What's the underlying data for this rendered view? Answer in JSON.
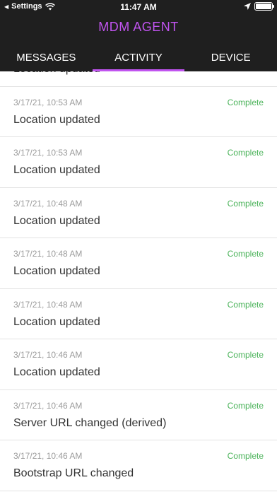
{
  "status_bar": {
    "back_label": "◀",
    "carrier": "Settings",
    "time": "11:47 AM",
    "battery_level": 1.0
  },
  "app": {
    "title": "MDM AGENT"
  },
  "tabs": [
    {
      "label": "MESSAGES",
      "active": false
    },
    {
      "label": "ACTIVITY",
      "active": true
    },
    {
      "label": "DEVICE",
      "active": false
    }
  ],
  "colors": {
    "accent": "#c154f0",
    "status_complete": "#4bb35a",
    "header_bg": "#1f1f1f"
  },
  "activity": [
    {
      "date": "",
      "title": "Location updated",
      "status": ""
    },
    {
      "date": "3/17/21, 10:53 AM",
      "title": "Location updated",
      "status": "Complete"
    },
    {
      "date": "3/17/21, 10:53 AM",
      "title": "Location updated",
      "status": "Complete"
    },
    {
      "date": "3/17/21, 10:48 AM",
      "title": "Location updated",
      "status": "Complete"
    },
    {
      "date": "3/17/21, 10:48 AM",
      "title": "Location updated",
      "status": "Complete"
    },
    {
      "date": "3/17/21, 10:48 AM",
      "title": "Location updated",
      "status": "Complete"
    },
    {
      "date": "3/17/21, 10:46 AM",
      "title": "Location updated",
      "status": "Complete"
    },
    {
      "date": "3/17/21, 10:46 AM",
      "title": "Server URL changed (derived)",
      "status": "Complete"
    },
    {
      "date": "3/17/21, 10:46 AM",
      "title": "Bootstrap URL changed",
      "status": "Complete"
    }
  ]
}
